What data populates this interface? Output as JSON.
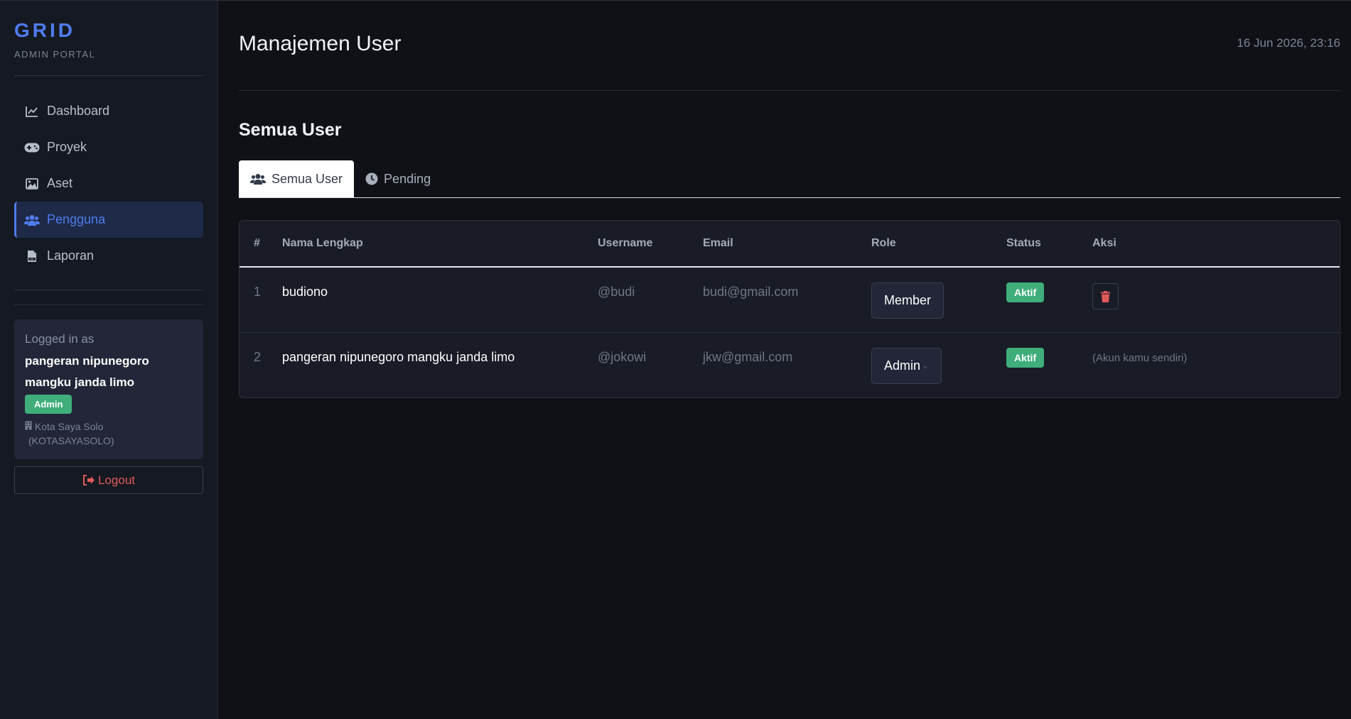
{
  "brand": {
    "title": "GRID",
    "subtitle": "ADMIN PORTAL"
  },
  "sidebar": {
    "items": [
      {
        "label": "Dashboard",
        "icon": "chart-line-icon"
      },
      {
        "label": "Proyek",
        "icon": "gamepad-icon"
      },
      {
        "label": "Aset",
        "icon": "image-icon"
      },
      {
        "label": "Pengguna",
        "icon": "users-icon",
        "active": true
      },
      {
        "label": "Laporan",
        "icon": "file-pdf-icon"
      }
    ]
  },
  "user_card": {
    "logged_label": "Logged in as",
    "name": "pangeran nipunegoro mangku janda limo",
    "role": "Admin",
    "org_name": "Kota Saya Solo",
    "org_code": "(KOTASAYASOLO)"
  },
  "logout_label": "Logout",
  "header": {
    "title": "Manajemen User",
    "timestamp": "16 Jun 2026, 23:16"
  },
  "section_title": "Semua User",
  "tabs": [
    {
      "label": "Semua User",
      "icon": "users-icon",
      "active": true
    },
    {
      "label": "Pending",
      "icon": "clock-icon"
    }
  ],
  "table": {
    "columns": [
      "#",
      "Nama Lengkap",
      "Username",
      "Email",
      "Role",
      "Status",
      "Aksi"
    ],
    "rows": [
      {
        "no": "1",
        "name": "budiono",
        "username": "@budi",
        "email": "budi@gmail.com",
        "role": "Member",
        "status": "Aktif"
      },
      {
        "no": "2",
        "name": "pangeran nipunegoro mangku janda limo",
        "username": "@jokowi",
        "email": "jkw@gmail.com",
        "role": "Admin",
        "status": "Aktif",
        "note": "(Akun kamu sendiri)"
      }
    ]
  },
  "colors": {
    "accent": "#4f7cf0",
    "success": "#3fae7b",
    "danger": "#e05a5a"
  }
}
